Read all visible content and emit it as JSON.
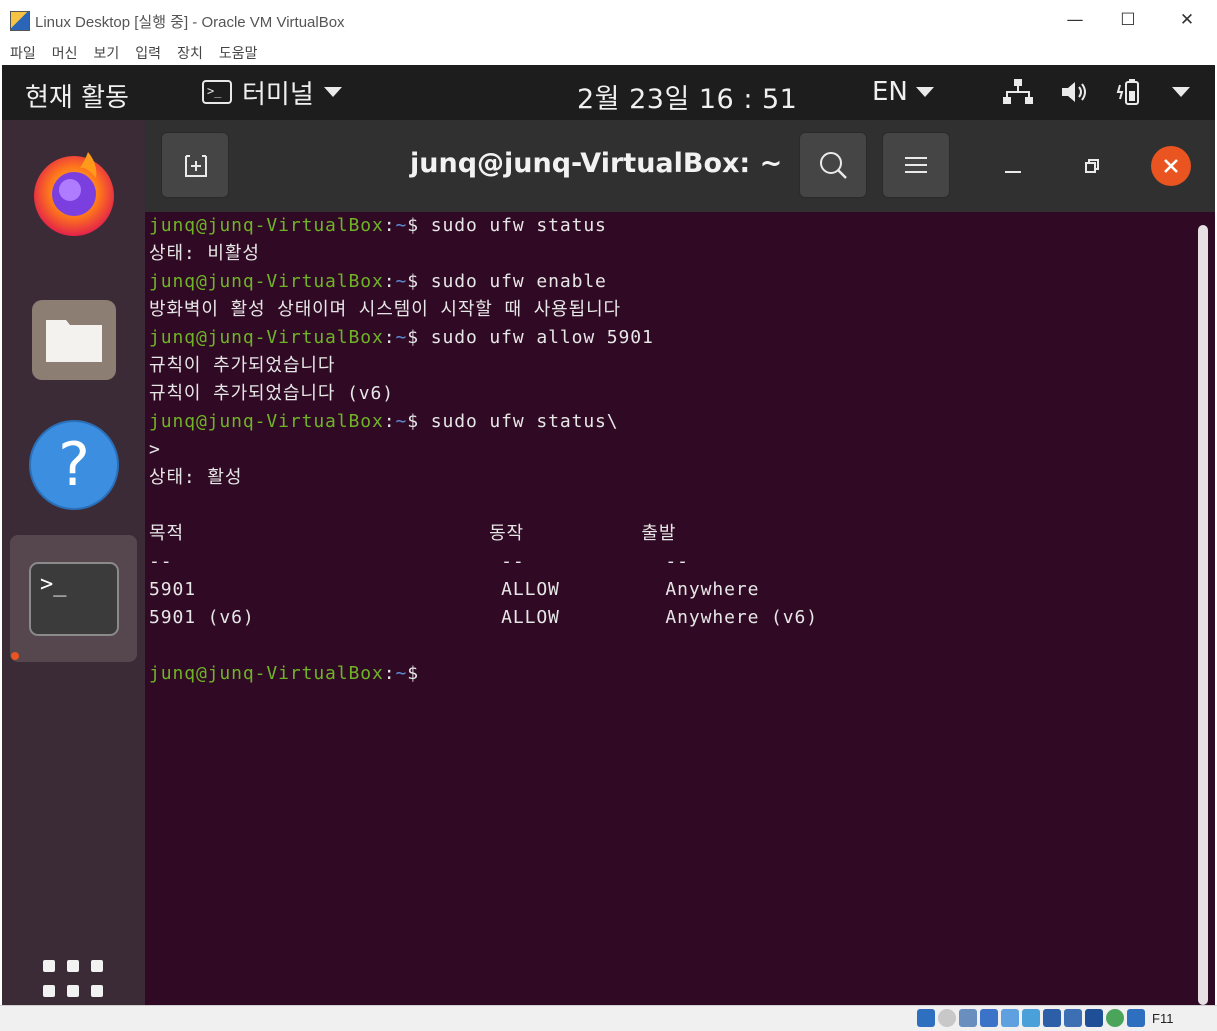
{
  "window": {
    "title": "Linux Desktop [실행 중] - Oracle VM VirtualBox",
    "menu": [
      "파일",
      "머신",
      "보기",
      "입력",
      "장치",
      "도움말"
    ],
    "controls": {
      "minimize": "—",
      "maximize": "☐",
      "close": "✕"
    }
  },
  "topbar": {
    "activities": "현재 활동",
    "app_name": "터미널",
    "clock": "2월 23일  16 : 51",
    "input_lang": "EN"
  },
  "dock": {
    "items": [
      "firefox-icon",
      "files-icon",
      "help-icon",
      "terminal-icon",
      "show-apps-icon"
    ],
    "active": "terminal"
  },
  "terminal": {
    "title": "junq@junq-VirtualBox: ~",
    "prompt": {
      "user": "junq@junq-VirtualBox",
      "sep": ":",
      "path": "~",
      "sym": "$ "
    },
    "lines": {
      "l1_cmd": "sudo ufw status",
      "l2": "상태: 비활성",
      "l3_cmd": "sudo ufw enable",
      "l4": "방화벽이 활성 상태이며 시스템이 시작할 때 사용됩니다",
      "l5_cmd": "sudo ufw allow 5901",
      "l6": "규칙이 추가되었습니다",
      "l7": "규칙이 추가되었습니다 (v6)",
      "l8_cmd": "sudo ufw status\\",
      "l9": ">",
      "l10": "상태: 활성",
      "l12": "목적                          동작          출발",
      "l13": "--                            --            --",
      "l14": "5901                          ALLOW         Anywhere",
      "l15": "5901 (v6)                     ALLOW         Anywhere (v6)"
    }
  },
  "status_bar": {
    "host_key": "F11"
  },
  "colors": {
    "terminal_bg": "#300a24",
    "prompt_user": "#6fb326",
    "prompt_path": "#5f8fd4",
    "accent": "#e95420"
  }
}
